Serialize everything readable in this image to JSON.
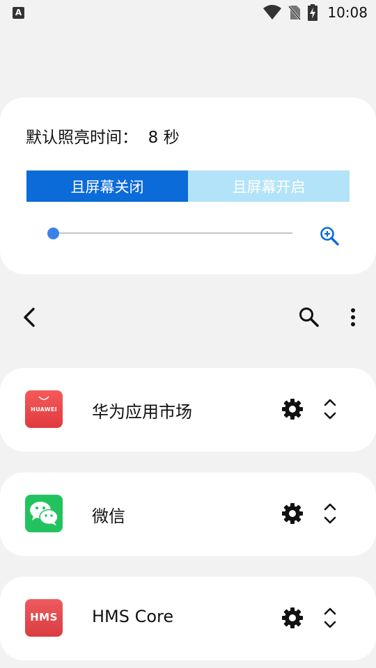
{
  "status_bar": {
    "notification_icon_letter": "A",
    "time": "10:08",
    "icons": [
      "wifi-icon",
      "no-sim-icon",
      "battery-charging-icon"
    ]
  },
  "light_panel": {
    "title": "默认照亮时间：  8 秒",
    "tabs": [
      {
        "label": "且屏幕关闭",
        "active": true
      },
      {
        "label": "且屏幕开启",
        "active": false
      }
    ],
    "slider_value_fraction": 0.0,
    "zoom_icon": "zoom-in-icon",
    "colors": {
      "active_tab": "#0b6bd8",
      "inactive_tab": "#b3e3f8",
      "slider_thumb": "#3b82e6"
    }
  },
  "toolbar": {
    "back_icon": "back-arrow-icon",
    "search_icon": "search-icon",
    "more_icon": "more-vertical-icon"
  },
  "apps": [
    {
      "name": "华为应用市场",
      "icon_label": "HUAWEI",
      "icon_color": "#e8464a"
    },
    {
      "name": "微信",
      "icon_label": "",
      "icon_color": "#22c35e"
    },
    {
      "name": "HMS Core",
      "icon_label": "HMS",
      "icon_color": "#e5484d"
    }
  ]
}
